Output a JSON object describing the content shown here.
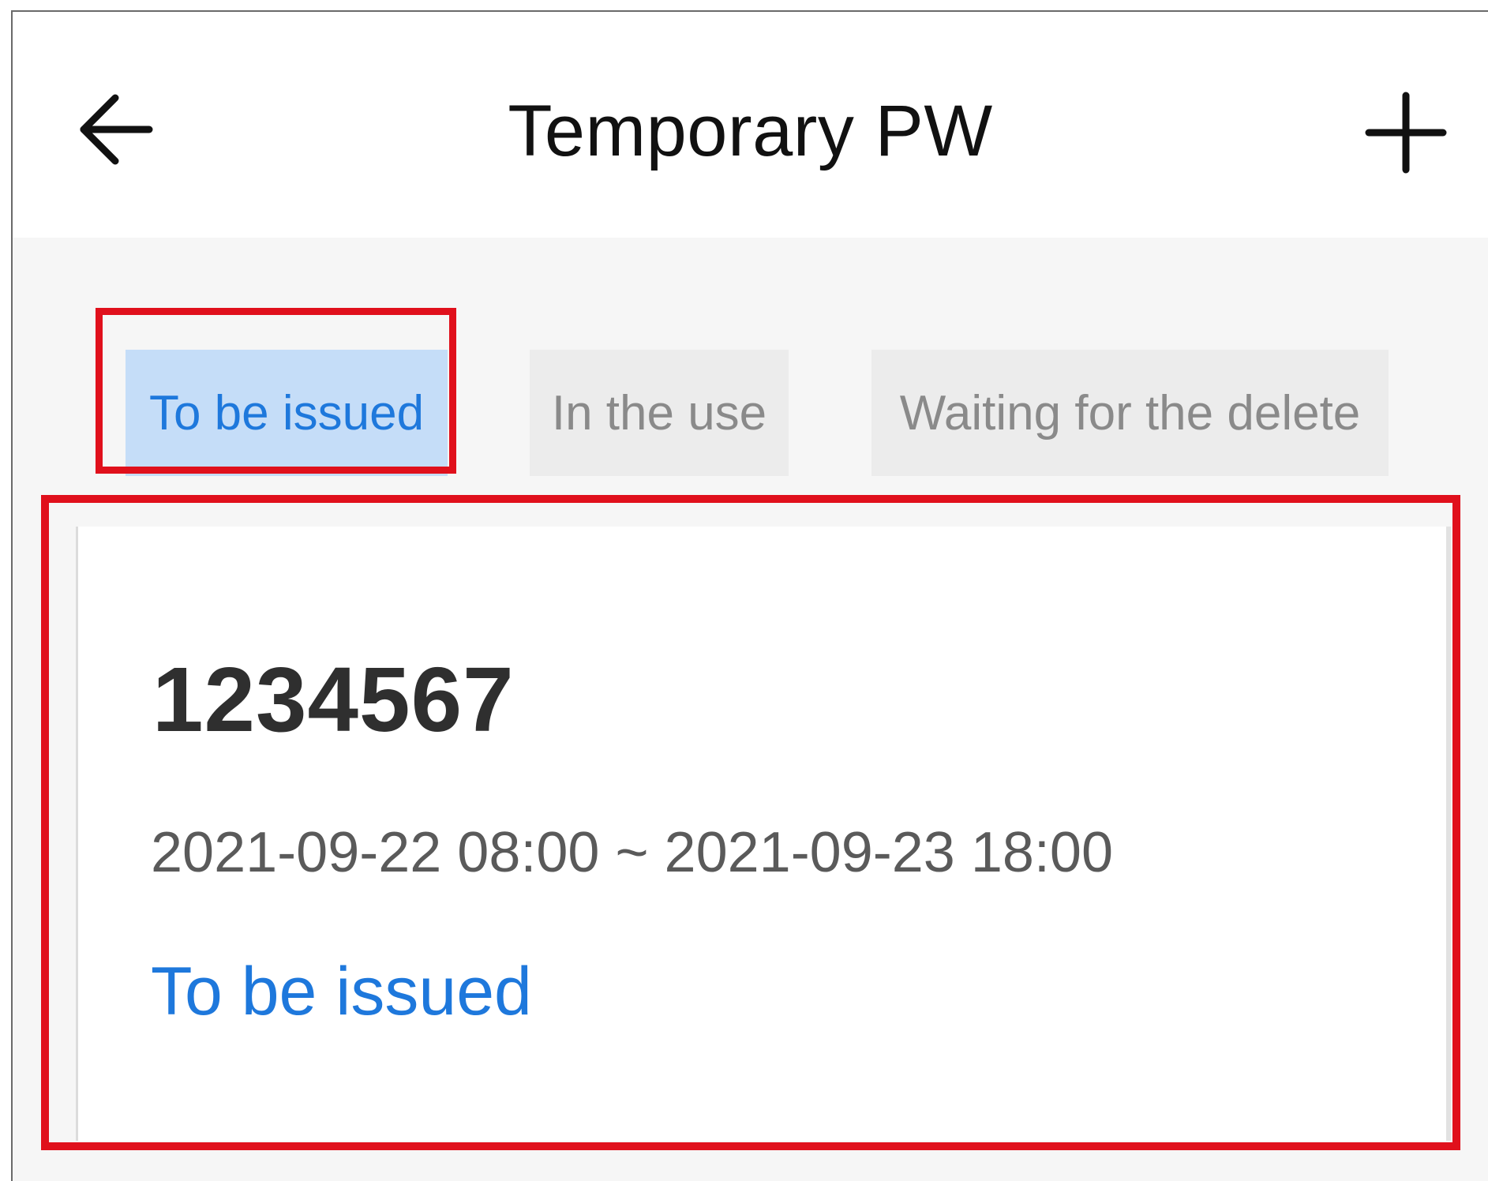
{
  "header": {
    "title": "Temporary PW",
    "back_icon": "arrow-left-icon",
    "add_icon": "plus-icon"
  },
  "tabs": [
    {
      "label": "To be issued",
      "active": true
    },
    {
      "label": "In the use",
      "active": false
    },
    {
      "label": "Waiting for the delete",
      "active": false
    }
  ],
  "passwords": [
    {
      "code": "1234567",
      "range": "2021-09-22 08:00 ~ 2021-09-23 18:00",
      "status": "To be issued"
    }
  ],
  "colors": {
    "accent": "#1e78dc",
    "active_tab_bg": "#c5ddf8",
    "inactive_tab_bg": "#ececec",
    "highlight": "#e0101c",
    "page_bg": "#f6f6f6"
  }
}
